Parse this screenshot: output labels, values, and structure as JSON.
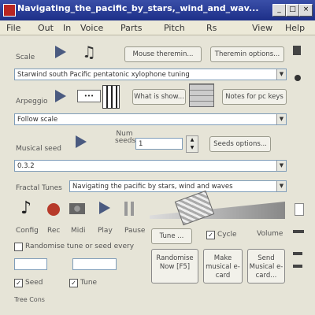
{
  "window": {
    "title": "Navigating_the_pacific_by_stars,_wind_and_wav...",
    "controls": [
      "_",
      "□",
      "×"
    ]
  },
  "menu": [
    "File",
    "Out",
    "In",
    "Voice",
    "Parts",
    "Pitch",
    "Rs",
    "View",
    "Help"
  ],
  "scale": {
    "label": "Scale",
    "mouse_btn": "Mouse theremin...",
    "theremin_btn": "Theremin options...",
    "value": "Starwind south Pacific pentatonic xylophone tuning"
  },
  "arpeggio": {
    "label": "Arpeggio",
    "show_btn": "What is show...",
    "notes_btn": "Notes for pc keys",
    "value": "Follow scale"
  },
  "seed": {
    "label": "Musical seed",
    "num_label": "Num seeds",
    "num_value": "1",
    "seeds_btn": "Seeds options...",
    "value": "0.3.2"
  },
  "fractal": {
    "label": "Fractal Tunes",
    "value": "Navigating the pacific by stars, wind and waves"
  },
  "tools": {
    "config": "Config",
    "rec": "Rec",
    "midi": "Midi",
    "play": "Play",
    "pause": "Pause"
  },
  "timing": {
    "tune_btn": "Tune ...",
    "cycle_label": "Cycle",
    "cycle_checked": true,
    "volume_label": "Volume"
  },
  "randomise": {
    "label": "Randomise tune or seed every"
  },
  "bottom": {
    "randomise_btn": "Randomise Now [F5]",
    "make_btn": "Make musical e-card",
    "send_btn": "Send Musical e-card..."
  },
  "checks": {
    "seed": "Seed",
    "tune": "Tune",
    "seed_checked": true,
    "tune_checked": true
  },
  "status": "Tree Cons"
}
